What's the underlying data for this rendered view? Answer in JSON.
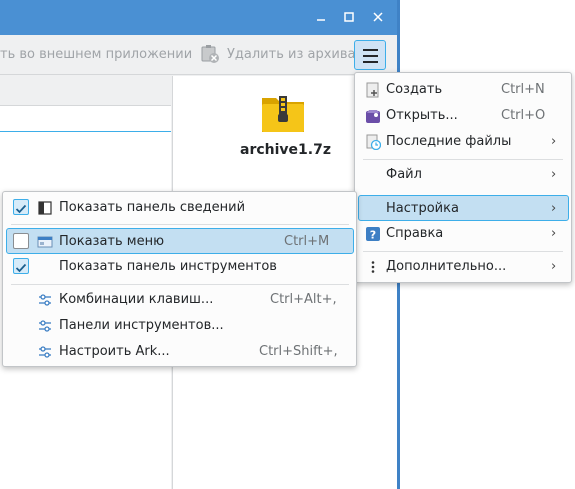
{
  "toolbar": {
    "open_external_label": "ть во внешнем приложении",
    "delete_label": "Удалить из архива"
  },
  "details": {
    "archive_name": "archive1.7z"
  },
  "main_menu": {
    "items": [
      {
        "label": "Создать",
        "shortcut": "Ctrl+N",
        "icon": "new-document-icon"
      },
      {
        "label": "Открыть...",
        "shortcut": "Ctrl+O",
        "icon": "open-archive-icon"
      },
      {
        "label": "Последние файлы",
        "icon": "recent-files-icon"
      },
      {
        "label": "Файл"
      },
      {
        "label": "Настройка"
      },
      {
        "label": "Справка",
        "icon": "help-icon"
      },
      {
        "label": "Дополнительно...",
        "icon": "more-icon"
      }
    ]
  },
  "settings_menu": {
    "items": [
      {
        "label": "Показать панель сведений",
        "checked": true,
        "icon": "sidebar-icon"
      },
      {
        "label": "Показать меню",
        "shortcut": "Ctrl+M",
        "checked": false,
        "icon": "menubar-icon"
      },
      {
        "label": "Показать панель инструментов",
        "checked": true
      },
      {
        "label": "Комбинации клавиш...",
        "shortcut": "Ctrl+Alt+,",
        "icon": "configure-icon"
      },
      {
        "label": "Панели инструментов...",
        "icon": "configure-icon"
      },
      {
        "label": "Настроить Ark...",
        "shortcut": "Ctrl+Shift+,",
        "icon": "configure-icon"
      }
    ]
  },
  "colors": {
    "accent": "#3daee9",
    "titlebar": "#4a90d3",
    "highlight": "#c3dff2"
  }
}
